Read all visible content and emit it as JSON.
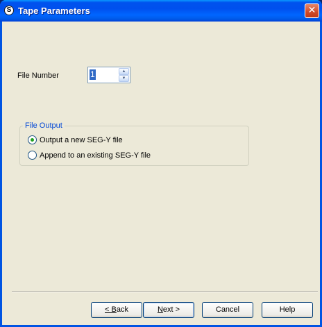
{
  "window": {
    "title": "Tape Parameters",
    "icon": "S"
  },
  "file_number": {
    "label": "File Number",
    "value": "1"
  },
  "file_output": {
    "legend": "File Output",
    "options": [
      {
        "label": "Output a new SEG-Y file",
        "selected": true
      },
      {
        "label": "Append to an existing SEG-Y file",
        "selected": false
      }
    ]
  },
  "buttons": {
    "back": {
      "underline": "< B",
      "rest": "ack"
    },
    "next": {
      "underline": "N",
      "rest": "ext >"
    },
    "cancel": "Cancel",
    "help": "Help"
  },
  "icons": {
    "close": "close-icon",
    "app": "app-logo-icon",
    "spin_up": "arrow-up-icon",
    "spin_down": "arrow-down-icon"
  }
}
